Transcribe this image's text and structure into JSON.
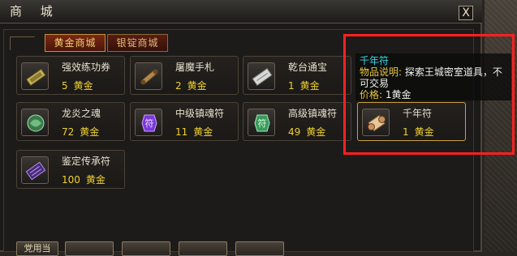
{
  "window": {
    "title": "商 城",
    "close_label": "X"
  },
  "tabs": [
    {
      "label": "黄金商城",
      "active": true
    },
    {
      "label": "银锭商城",
      "active": false
    }
  ],
  "currency": "黄金",
  "items": [
    {
      "name": "强效练功券",
      "price": "5",
      "icon": "scroll-ticket-icon"
    },
    {
      "name": "屠魔手札",
      "price": "2",
      "icon": "rolled-scroll-icon"
    },
    {
      "name": "乾台通宝",
      "price": "1",
      "icon": "silver-coin-bar-icon"
    },
    {
      "name": "龙炎之魂",
      "price": "72",
      "icon": "dragon-soul-orb-icon"
    },
    {
      "name": "中级镇魂符",
      "price": "11",
      "icon": "purple-talisman-icon"
    },
    {
      "name": "高级镇魂符",
      "price": "49",
      "icon": "green-talisman-icon"
    },
    {
      "name": "千年符",
      "price": "1",
      "icon": "ancient-scroll-icon"
    },
    {
      "name": "鉴定传承符",
      "price": "100",
      "icon": "purple-rune-book-icon"
    }
  ],
  "tooltip": {
    "title": "千年符",
    "desc_label": "物品说明:",
    "desc": "探索王城密室道具，不可交易",
    "price_label": "价格:",
    "price_value": "1黄金"
  },
  "bottom": {
    "button_label": "党用当"
  },
  "colors": {
    "gold_text": "#f0d030",
    "highlight": "#ff2020",
    "tooltip_title": "#30d8e8"
  }
}
